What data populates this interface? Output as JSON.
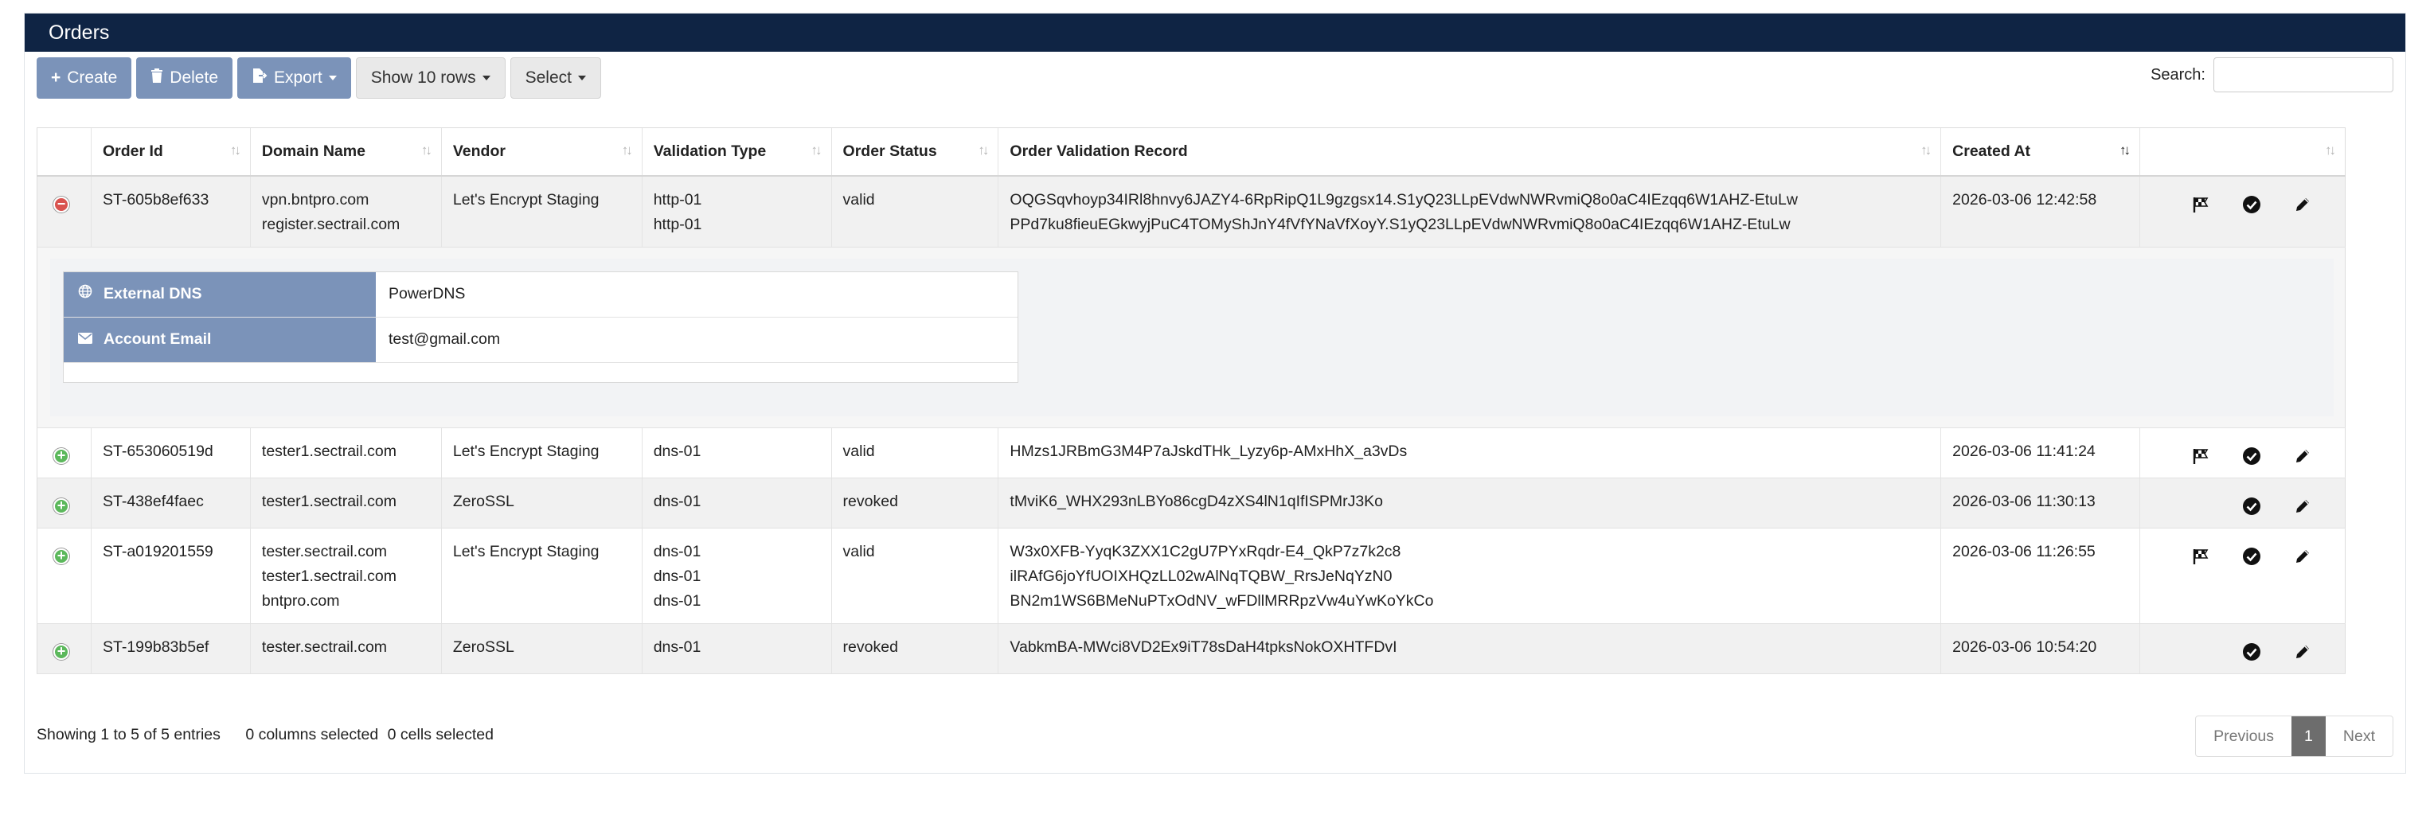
{
  "header": {
    "title": "Orders"
  },
  "toolbar": {
    "create": "Create",
    "delete": "Delete",
    "export": "Export",
    "show_rows": "Show 10 rows",
    "select": "Select"
  },
  "search": {
    "label": "Search:",
    "value": ""
  },
  "columns": [
    "Order Id",
    "Domain Name",
    "Vendor",
    "Validation Type",
    "Order Status",
    "Order Validation Record",
    "Created At"
  ],
  "rows": [
    {
      "id": "ST-605b8ef633",
      "domains": [
        "vpn.bntpro.com",
        "register.sectrail.com"
      ],
      "vendor": "Let's Encrypt Staging",
      "validation": [
        "http-01",
        "http-01"
      ],
      "status": "valid",
      "records": [
        "OQGSqvhoyp34IRl8hnvy6JAZY4-6RpRipQ1L9gzgsx14.S1yQ23LLpEVdwNWRvmiQ8o0aC4IEzqq6W1AHZ-EtuLw",
        "PPd7ku8fieuEGkwyjPuC4TOMyShJnY4fVfYNaVfXoyY.S1yQ23LLpEVdwNWRvmiQ8o0aC4IEzqq6W1AHZ-EtuLw"
      ],
      "created": "2026-03-06 12:42:58",
      "expanded": true,
      "flag": true
    },
    {
      "id": "ST-653060519d",
      "domains": [
        "tester1.sectrail.com"
      ],
      "vendor": "Let's Encrypt Staging",
      "validation": [
        "dns-01"
      ],
      "status": "valid",
      "records": [
        "HMzs1JRBmG3M4P7aJskdTHk_Lyzy6p-AMxHhX_a3vDs"
      ],
      "created": "2026-03-06 11:41:24",
      "flag": true
    },
    {
      "id": "ST-438ef4faec",
      "domains": [
        "tester1.sectrail.com"
      ],
      "vendor": "ZeroSSL",
      "validation": [
        "dns-01"
      ],
      "status": "revoked",
      "records": [
        "tMviK6_WHX293nLBYo86cgD4zXS4lN1qIfISPMrJ3Ko"
      ],
      "created": "2026-03-06 11:30:13",
      "flag": false
    },
    {
      "id": "ST-a019201559",
      "domains": [
        "tester.sectrail.com",
        "tester1.sectrail.com",
        "bntpro.com"
      ],
      "vendor": "Let's Encrypt Staging",
      "validation": [
        "dns-01",
        "dns-01",
        "dns-01"
      ],
      "status": "valid",
      "records": [
        "W3x0XFB-YyqK3ZXX1C2gU7PYxRqdr-E4_QkP7z7k2c8",
        "ilRAfG6joYfUOIXHQzLL02wAlNqTQBW_RrsJeNqYzN0",
        "BN2m1WS6BMeNuPTxOdNV_wFDllMRRpzVw4uYwKoYkCo"
      ],
      "created": "2026-03-06 11:26:55",
      "flag": true
    },
    {
      "id": "ST-199b83b5ef",
      "domains": [
        "tester.sectrail.com"
      ],
      "vendor": "ZeroSSL",
      "validation": [
        "dns-01"
      ],
      "status": "revoked",
      "records": [
        "VabkmBA-MWci8VD2Ex9iT78sDaH4tpksNokOXHTFDvI"
      ],
      "created": "2026-03-06 10:54:20",
      "flag": false
    }
  ],
  "detail": {
    "dns_label": "External DNS",
    "dns_value": "PowerDNS",
    "email_label": "Account Email",
    "email_value": "test@gmail.com"
  },
  "footer": {
    "info": "Showing 1 to 5 of 5 entries",
    "columns_selected": "0 columns selected",
    "cells_selected": "0 cells selected"
  },
  "pager": {
    "previous": "Previous",
    "current": "1",
    "next": "Next"
  }
}
